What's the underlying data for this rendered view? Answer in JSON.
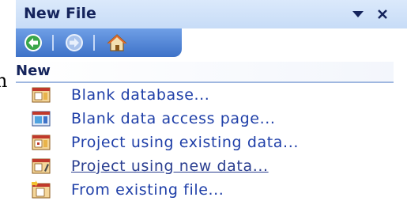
{
  "background_text": "n",
  "pane": {
    "title": "New File",
    "section_header": "New",
    "items": [
      {
        "label": "Blank database...",
        "icon": "database-icon"
      },
      {
        "label": "Blank data access page...",
        "icon": "data-access-page-icon"
      },
      {
        "label": "Project using existing data...",
        "icon": "project-existing-data-icon"
      },
      {
        "label": "Project using new data...",
        "icon": "project-new-data-icon"
      },
      {
        "label": "From existing file...",
        "icon": "existing-file-icon"
      }
    ]
  },
  "nav_buttons": [
    "back-icon",
    "forward-icon",
    "home-icon"
  ],
  "colors": {
    "title_text": "#15245c",
    "link_text": "#1f3fa8",
    "nav_bar": "#3e72c8",
    "title_bar": "#c7dcf7"
  }
}
